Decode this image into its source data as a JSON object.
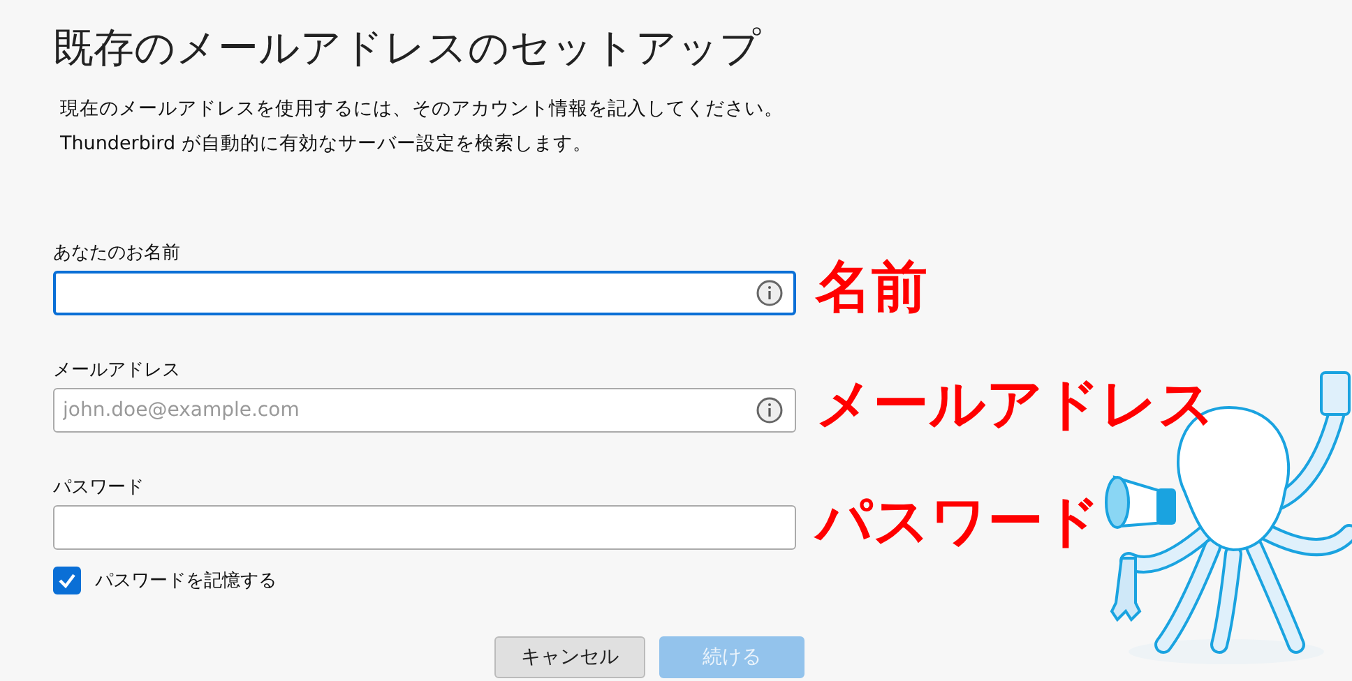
{
  "title": "既存のメールアドレスのセットアップ",
  "description": [
    "現在のメールアドレスを使用するには、そのアカウント情報を記入してください。",
    "Thunderbird が自動的に有効なサーバー設定を検索します。"
  ],
  "fields": [
    {
      "label": "あなたのお名前",
      "focused": true,
      "info": true,
      "annotation": "名前"
    },
    {
      "label": "メールアドレス",
      "placeholder": "john.doe@example.com",
      "focused": false,
      "info": true,
      "annotation": "メールアドレス"
    },
    {
      "label": "パスワード",
      "focused": false,
      "info": false,
      "annotation": "パスワード"
    }
  ],
  "remember_password": {
    "label": "パスワードを記憶する",
    "checked": true
  },
  "buttons": [
    {
      "label": "キャンセル",
      "disabled": false
    },
    {
      "label": "続ける",
      "disabled": true
    }
  ]
}
